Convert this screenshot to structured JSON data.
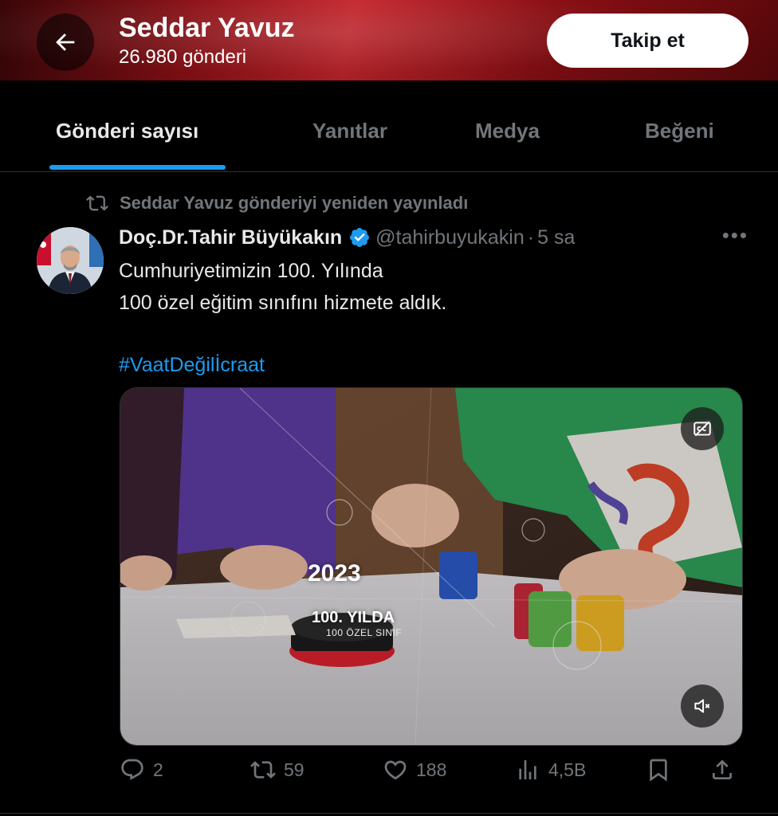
{
  "header": {
    "title": "Seddar Yavuz",
    "post_count": "26.980 gönderi",
    "follow_label": "Takip et",
    "back_icon": "arrow-left-icon"
  },
  "tabs": [
    {
      "label": "Gönderi sayısı",
      "active": true
    },
    {
      "label": "Yanıtlar",
      "active": false
    },
    {
      "label": "Medya",
      "active": false
    },
    {
      "label": "Beğeni",
      "active": false
    }
  ],
  "tweet": {
    "repost_note": "Seddar Yavuz gönderiyi yeniden yayınladı",
    "author_name": "Doç.Dr.Tahir Büyükakın",
    "verified": true,
    "handle": "@tahirbuyukakin",
    "separator": "·",
    "time": "5 sa",
    "more_label": "•••",
    "text_line1": "Cumhuriyetimizin 100. Yılında",
    "text_line2": "100 özel eğitim sınıfını hizmete aldık.",
    "hashtag": "#VaatDeğilİcraat",
    "media": {
      "overlay_year": "2023",
      "overlay_line1": "100. YILDA",
      "overlay_line2": "100 ÖZEL SINIF",
      "captions_icon": "captions-off-icon",
      "mute_icon": "speaker-muted-icon"
    },
    "actions": {
      "replies": "2",
      "reposts": "59",
      "likes": "188",
      "views": "4,5B"
    }
  },
  "colors": {
    "accent": "#1d9bf0",
    "header_red": "#c6262d",
    "muted_text": "#71767b",
    "background": "#000000"
  }
}
